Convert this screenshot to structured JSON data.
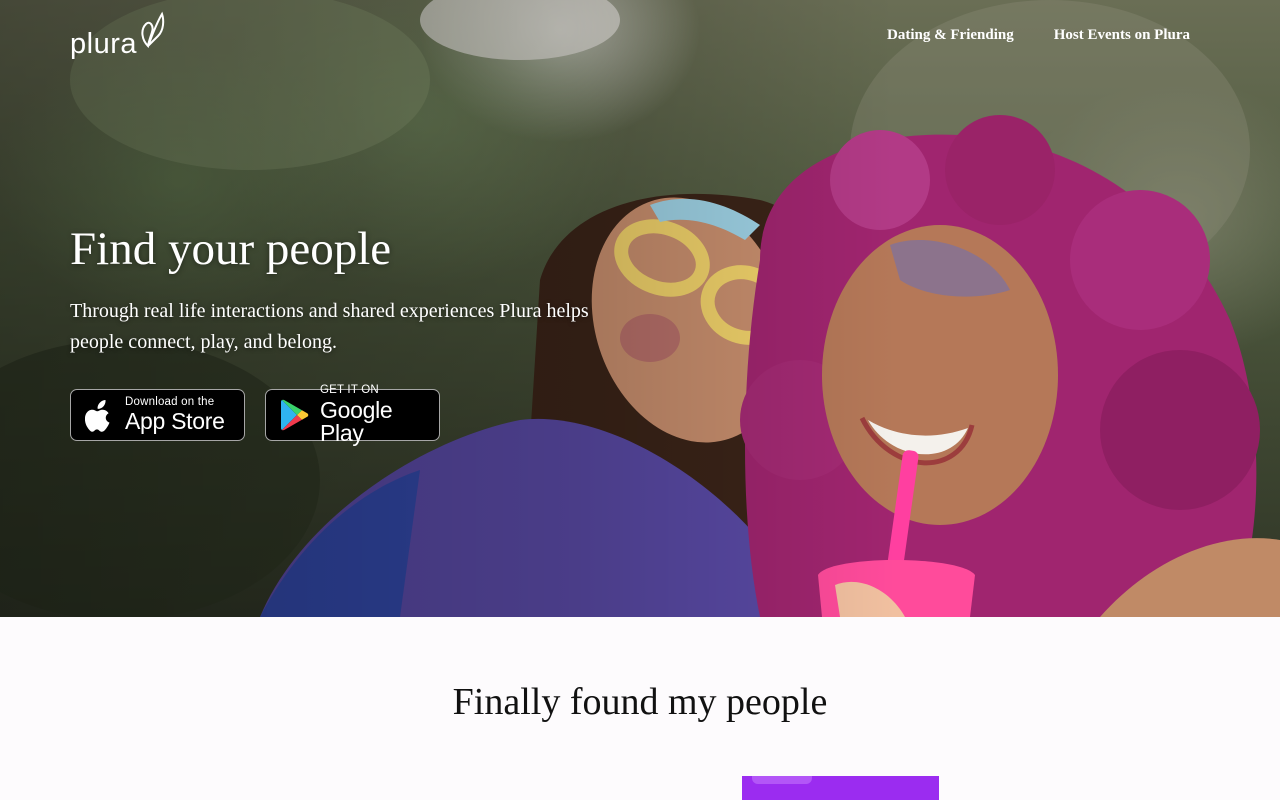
{
  "brand": {
    "name": "plura"
  },
  "nav": {
    "items": [
      {
        "label": "Dating & Friending"
      },
      {
        "label": "Host Events on Plura"
      }
    ]
  },
  "hero": {
    "title": "Find your people",
    "subtitle": "Through real life interactions and shared experiences Plura helps people connect, play, and belong.",
    "app_store": {
      "small": "Download on the",
      "big": "App Store",
      "icon": "apple-icon"
    },
    "google_play": {
      "small": "GET IT ON",
      "big": "Google Play",
      "icon": "google-play-icon"
    }
  },
  "section": {
    "title": "Finally found my people"
  },
  "colors": {
    "accent_purple": "#9b2cf0",
    "button_bg": "#000000",
    "text_white": "#ffffff"
  }
}
